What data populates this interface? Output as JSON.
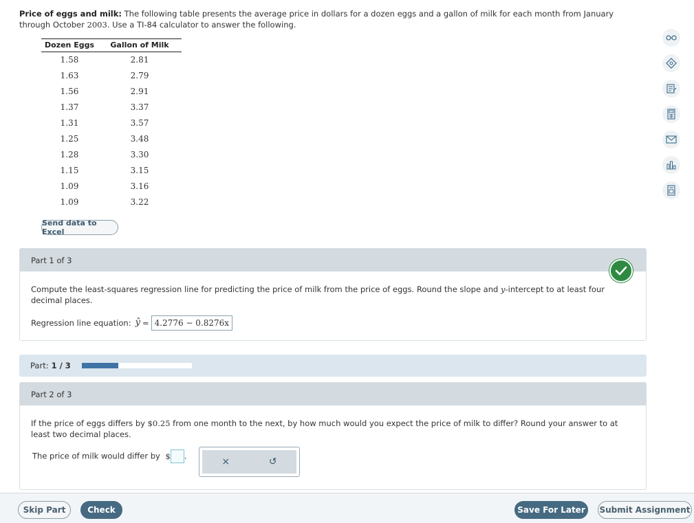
{
  "intro": {
    "bold": "Price of eggs and milk:",
    "text_a": " The following table presents the average price in dollars for a dozen eggs and a gallon of milk for each month from January through October ",
    "year": "2003",
    "text_b": ". Use a TI-84 calculator to answer the following."
  },
  "table": {
    "headers": [
      "Dozen Eggs",
      "Gallon of Milk"
    ],
    "rows": [
      [
        "1.58",
        "2.81"
      ],
      [
        "1.63",
        "2.79"
      ],
      [
        "1.56",
        "2.91"
      ],
      [
        "1.37",
        "3.37"
      ],
      [
        "1.31",
        "3.57"
      ],
      [
        "1.25",
        "3.48"
      ],
      [
        "1.28",
        "3.30"
      ],
      [
        "1.15",
        "3.15"
      ],
      [
        "1.09",
        "3.16"
      ],
      [
        "1.09",
        "3.22"
      ]
    ]
  },
  "send_excel_label": "Send data to Excel",
  "side_icons": [
    "glasses-icon",
    "ai-tutor-icon",
    "notes-icon",
    "calculator-icon",
    "mail-icon",
    "chart-icon",
    "document-icon"
  ],
  "part1": {
    "header": "Part 1 of 3",
    "question": "Compute the least-squares regression line for predicting the price of milk from the price of eggs. Round the slope and ",
    "question_var": "y",
    "question_end": "-intercept to at least four decimal places.",
    "eq_label": "Regression line equation:",
    "yhat": "ŷ",
    "eq_equals": "=",
    "answer": "4.2776 − 0.8276x"
  },
  "progress": {
    "label": "Part:",
    "value": "1 / 3",
    "fraction": 0.333
  },
  "part2": {
    "header": "Part 2 of 3",
    "question_a": "If the price of eggs differs by ",
    "question_amount": "$0.25",
    "question_b": " from one month to the next, by how much would you expect the price of milk to differ? Round your answer to at least two decimal places.",
    "answer_label": "The price of milk would differ by",
    "dollar": "$",
    "period": "."
  },
  "popup": {
    "clear": "×",
    "undo": "↺"
  },
  "footer": {
    "skip": "Skip Part",
    "check": "Check",
    "save": "Save For Later",
    "submit": "Submit Assignment"
  }
}
